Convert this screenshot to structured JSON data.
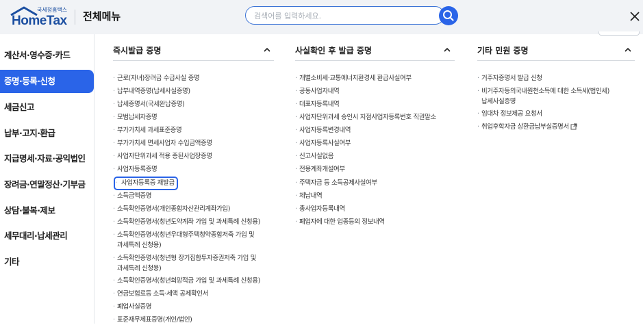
{
  "header": {
    "logo_text": "HomeTax",
    "logo_sub": "국세청홈택스",
    "title": "전체메뉴",
    "search_placeholder": "검색어를 입력하세요.",
    "search_icon": "search-icon",
    "close_icon": "close-icon"
  },
  "sidebar": {
    "items": [
      {
        "label": "계산서·영수증·카드"
      },
      {
        "label": "증명·등록·신청"
      },
      {
        "label": "세금신고"
      },
      {
        "label": "납부·고지·환급"
      },
      {
        "label": "지급명세·자료·공익법인"
      },
      {
        "label": "장려금·연말정산·기부금"
      },
      {
        "label": "상담·불복·제보"
      },
      {
        "label": "세무대리·납세관리"
      },
      {
        "label": "기타"
      }
    ],
    "active_index": 1
  },
  "columns": [
    {
      "heading": "즉시발급 증명",
      "items": [
        {
          "label": "근로(자녀)장려금 수급사실 증명"
        },
        {
          "label": "납부내역증명(납세사실증명)"
        },
        {
          "label": "납세증명서(국세완납증명)"
        },
        {
          "label": "모범납세자증명"
        },
        {
          "label": "부가가치세 과세표준증명"
        },
        {
          "label": "부가가치세 면세사업자 수입금액증명"
        },
        {
          "label": "사업자단위과세 적용 종된사업장증명"
        },
        {
          "label": "사업자등록증명"
        },
        {
          "label": "사업자등록증 재발급"
        },
        {
          "label": "소득금액증명"
        },
        {
          "label": "소득확인증명서(개인종합자산관리계좌가입)"
        },
        {
          "label": "소득확인증명서(청년도약계좌 가입 및 과세특례 신청용)"
        },
        {
          "label": "소득확인증명서(청년우대형주택청약종합저축 가입 및"
        },
        {
          "label": "과세특례 신청용)"
        },
        {
          "label": "소득확인증명서(청년형 장기집합투자증권저축 가입 및"
        },
        {
          "label": "과세특례 신청용)"
        },
        {
          "label": "소득확인증명서(청년희망적금 가입 및 과세특례 신청용)"
        },
        {
          "label": "연금보험료등 소득·세액 공제확인서"
        },
        {
          "label": "폐업사실증명"
        },
        {
          "label": "표준재무제표증명(개인/법인)"
        }
      ]
    },
    {
      "heading": "사실확인 후 발급 증명",
      "items": [
        {
          "label": "개별소비세·교통에너지환경세 환급사실여부"
        },
        {
          "label": "공동사업자내역"
        },
        {
          "label": "대표자등록내역"
        },
        {
          "label": "사업자단위과세 승인시 지점사업자등록번호 직권말소"
        },
        {
          "label": "사업자등록변경내역"
        },
        {
          "label": "사업자등록사실여부"
        },
        {
          "label": "신고사실없음"
        },
        {
          "label": "전용계좌개설여부"
        },
        {
          "label": "주택자금 등 소득공제사실여부"
        },
        {
          "label": "체납내역"
        },
        {
          "label": "총사업자등록내역"
        },
        {
          "label": "폐업자에 대한 업종등의 정보내역"
        }
      ]
    },
    {
      "heading": "기타 민원 증명",
      "items": [
        {
          "label": "거주자증명서 발급 신청"
        },
        {
          "label": "비거주자등의국내원천소득에 대한 소득세(법인세)"
        },
        {
          "label": "납세사실증명"
        },
        {
          "label": "임대차 정보제공 요청서"
        },
        {
          "label": "취업후학자금 상환금납부실증명서"
        }
      ]
    }
  ],
  "colors": {
    "accent": "#2a64e8",
    "header_bg": "#f1f3f6",
    "logo": "#1c4fa1"
  }
}
